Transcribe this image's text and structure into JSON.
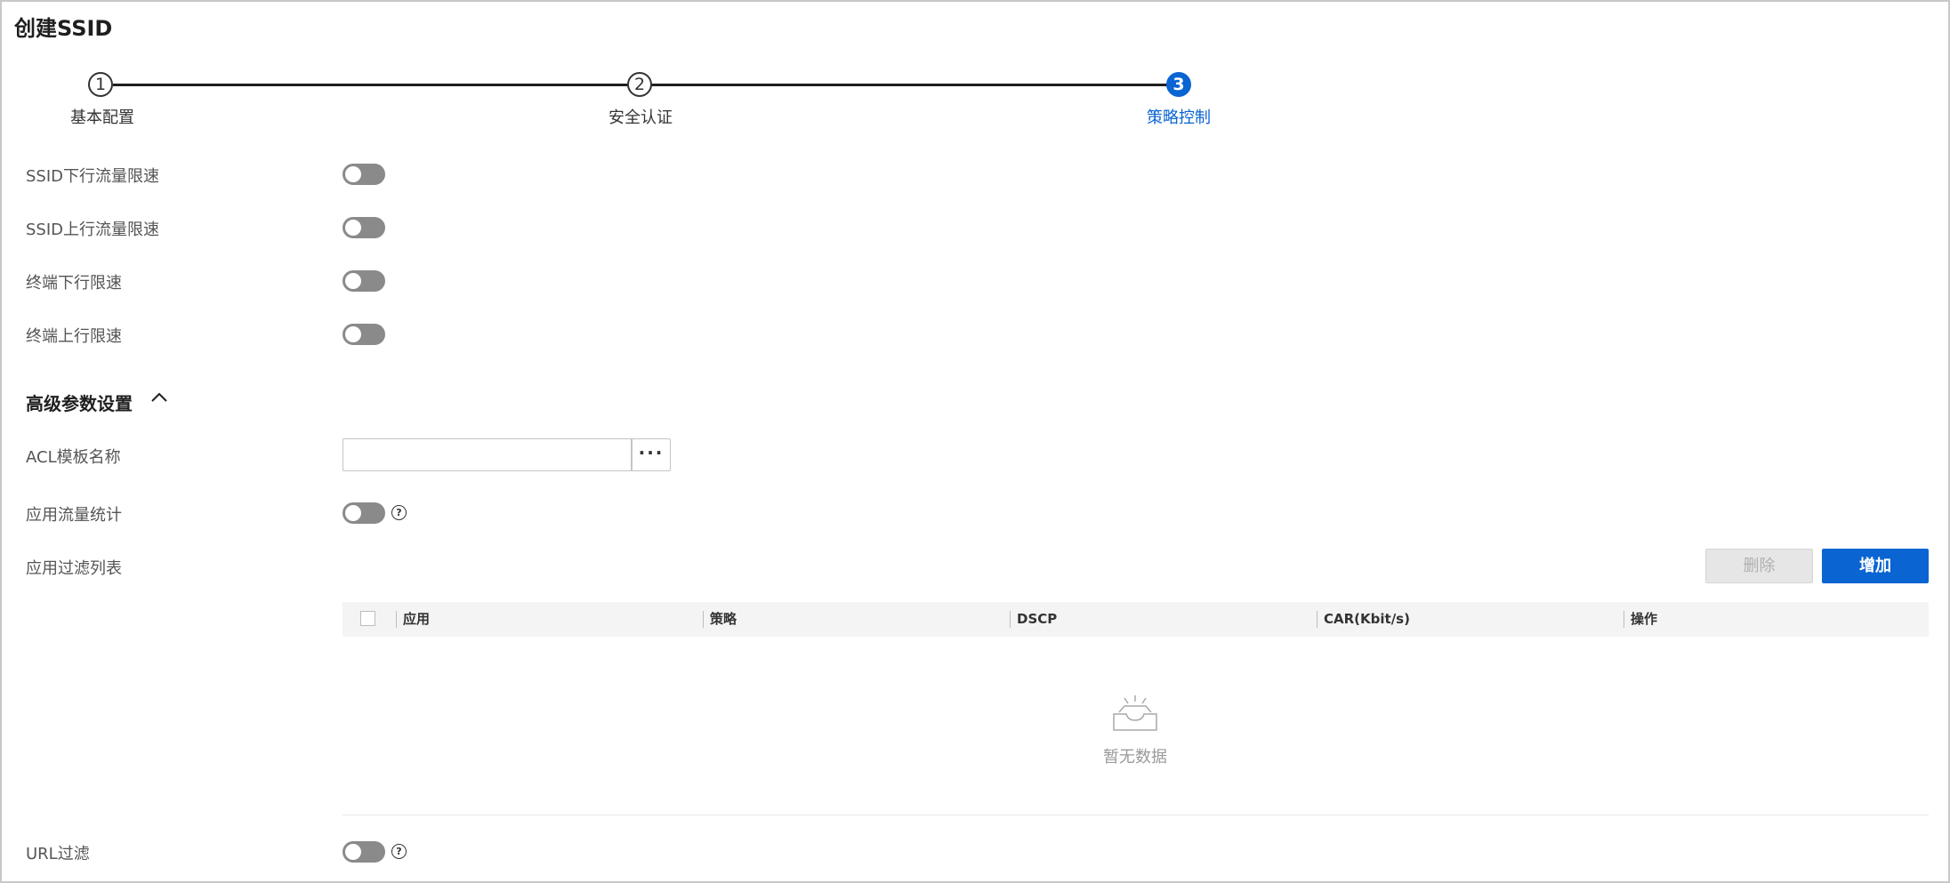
{
  "title": "创建SSID",
  "steps": [
    {
      "number": "1",
      "label": "基本配置"
    },
    {
      "number": "2",
      "label": "安全认证"
    },
    {
      "number": "3",
      "label": "策略控制"
    }
  ],
  "fields": {
    "ssid_down": {
      "label": "SSID下行流量限速",
      "enabled": false
    },
    "ssid_up": {
      "label": "SSID上行流量限速",
      "enabled": false
    },
    "term_down": {
      "label": "终端下行限速",
      "enabled": false
    },
    "term_up": {
      "label": "终端上行限速",
      "enabled": false
    }
  },
  "advanced": {
    "title": "高级参数设置",
    "acl": {
      "label": "ACL模板名称",
      "value": "",
      "more": "···"
    },
    "app_stats": {
      "label": "应用流量统计",
      "enabled": false
    },
    "app_filter": {
      "label": "应用过滤列表"
    },
    "url_filter": {
      "label": "URL过滤",
      "enabled": false
    }
  },
  "buttons": {
    "delete": "删除",
    "add": "增加"
  },
  "table": {
    "columns": [
      "应用",
      "策略",
      "DSCP",
      "CAR(Kbit/s)",
      "操作"
    ],
    "rows": [],
    "empty_text": "暂无数据"
  },
  "help_glyph": "?",
  "colors": {
    "accent": "#0a64d1",
    "toggle_off": "#8a8a8a"
  }
}
